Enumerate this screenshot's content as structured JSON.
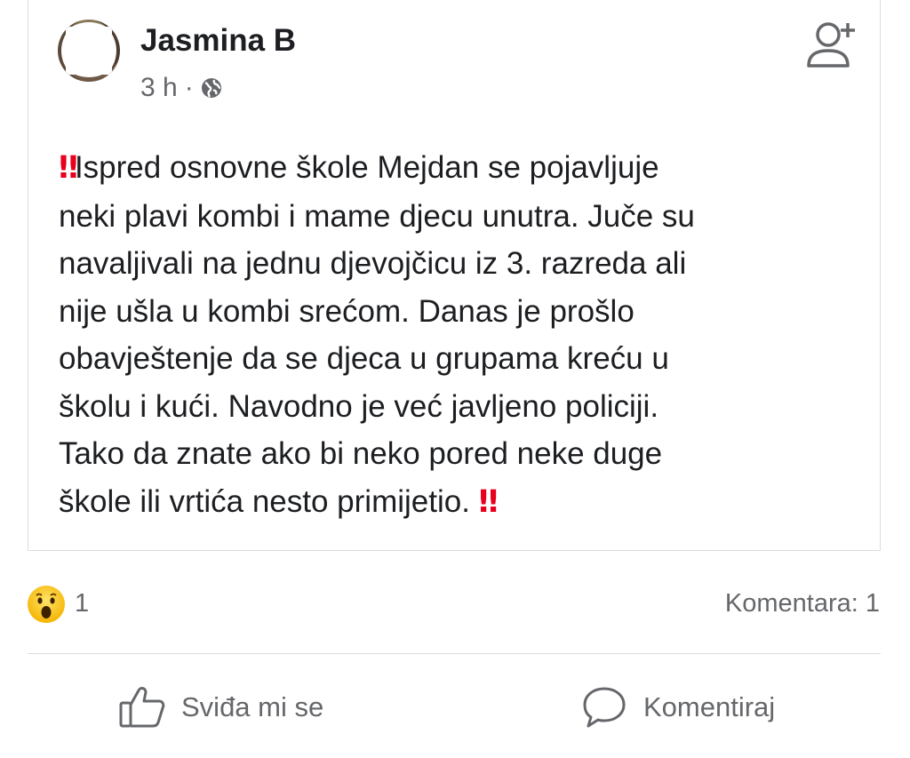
{
  "post": {
    "author": "Jasmina B",
    "time": "3 h",
    "separator": "·",
    "privacy_icon": "globe-icon",
    "add_friend_icon": "add-friend-icon",
    "text_line_1": "Ispred osnovne škole Mejdan se pojavljuje",
    "text_middle": "neki plavi kombi i mame djecu unutra. Juče su\nnavaljivali na jednu djevojčicu iz 3. razreda ali\nnije ušla u kombi srećom. Danas je prošlo\nobavještenje da se djeca u grupama kreću u\nškolu i kući. Navodno je već javljeno policiji.\nTako da znate ako bi neko pored neke duge",
    "text_last": "škole ili vrtića nesto primijetio. ",
    "emphasis_emoji": "‼"
  },
  "reactions": {
    "icon": "wow-reaction-icon",
    "count": "1",
    "comments_label": "Komentara: 1"
  },
  "actions": {
    "like_label": "Sviđa mi se",
    "comment_label": "Komentiraj"
  },
  "colors": {
    "text": "#1c1e21",
    "secondary": "#65676b",
    "emoji_red": "#e8001c",
    "divider": "#dadde1"
  }
}
